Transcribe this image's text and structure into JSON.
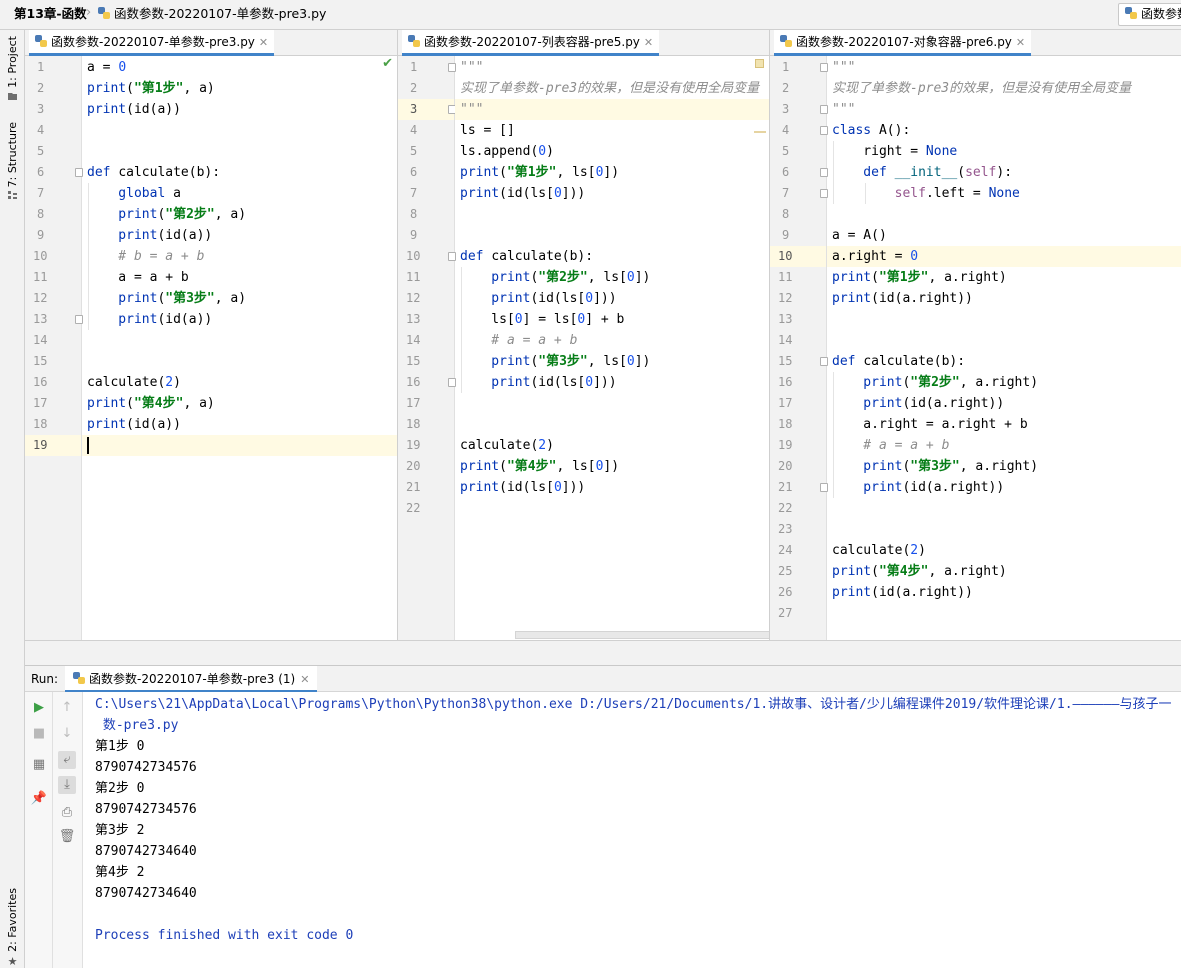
{
  "nav": {
    "crumbs": [
      "第13章-函数",
      "函数参数-20220107-单参数-pre3.py"
    ],
    "run_config": "函数参数"
  },
  "left_strip": {
    "project_tab": "1: Project",
    "structure_tab": "7: Structure",
    "favorites_tab": "2: Favorites"
  },
  "editors": [
    {
      "tab": "函数参数-20220107-单参数-pre3.py",
      "current_line": 19,
      "lines": [
        [
          [
            "a = ",
            ""
          ],
          [
            "0",
            "num"
          ]
        ],
        [
          [
            "print",
            "kw"
          ],
          [
            "(",
            ""
          ],
          [
            "\"第1步\"",
            "str"
          ],
          [
            ", a)",
            ""
          ]
        ],
        [
          [
            "print",
            "kw"
          ],
          [
            "(id(a))",
            ""
          ]
        ],
        [],
        [],
        [
          [
            "def ",
            "kw"
          ],
          [
            "calculate",
            ""
          ],
          [
            "(b):",
            ""
          ]
        ],
        [
          [
            "    global ",
            "kw"
          ],
          [
            "a",
            ""
          ]
        ],
        [
          [
            "    print",
            "kw"
          ],
          [
            "(",
            ""
          ],
          [
            "\"第2步\"",
            "str"
          ],
          [
            ", a)",
            ""
          ]
        ],
        [
          [
            "    print",
            "kw"
          ],
          [
            "(id(a))",
            ""
          ]
        ],
        [
          [
            "    # b = a + b",
            "cmt"
          ]
        ],
        [
          [
            "    a = a + b",
            ""
          ]
        ],
        [
          [
            "    print",
            "kw"
          ],
          [
            "(",
            ""
          ],
          [
            "\"第3步\"",
            "str"
          ],
          [
            ", a)",
            ""
          ]
        ],
        [
          [
            "    print",
            "kw"
          ],
          [
            "(id(a))",
            ""
          ]
        ],
        [],
        [],
        [
          [
            "calculate(",
            ""
          ],
          [
            "2",
            "num"
          ],
          [
            ")",
            ""
          ]
        ],
        [
          [
            "print",
            "kw"
          ],
          [
            "(",
            ""
          ],
          [
            "\"第4步\"",
            "str"
          ],
          [
            ", a)",
            ""
          ]
        ],
        [
          [
            "print",
            "kw"
          ],
          [
            "(id(a))",
            ""
          ]
        ],
        []
      ]
    },
    {
      "tab": "函数参数-20220107-列表容器-pre5.py",
      "current_line": 3,
      "lines": [
        [
          [
            "\"\"\"",
            "cmt"
          ]
        ],
        [
          [
            "实现了单参数-pre3的效果，但是没有使用全局变量",
            "cmt"
          ]
        ],
        [
          [
            "\"\"\"",
            "cmt"
          ]
        ],
        [
          [
            "ls = []",
            ""
          ]
        ],
        [
          [
            "ls.append(",
            ""
          ],
          [
            "0",
            "num"
          ],
          [
            ")",
            ""
          ]
        ],
        [
          [
            "print",
            "kw"
          ],
          [
            "(",
            ""
          ],
          [
            "\"第1步\"",
            "str"
          ],
          [
            ", ls[",
            ""
          ],
          [
            "0",
            "num"
          ],
          [
            "])",
            ""
          ]
        ],
        [
          [
            "print",
            "kw"
          ],
          [
            "(id(ls[",
            ""
          ],
          [
            "0",
            "num"
          ],
          [
            "]))",
            ""
          ]
        ],
        [],
        [],
        [
          [
            "def ",
            "kw"
          ],
          [
            "calculate",
            ""
          ],
          [
            "(b):",
            ""
          ]
        ],
        [
          [
            "    print",
            "kw"
          ],
          [
            "(",
            ""
          ],
          [
            "\"第2步\"",
            "str"
          ],
          [
            ", ls[",
            ""
          ],
          [
            "0",
            "num"
          ],
          [
            "])",
            ""
          ]
        ],
        [
          [
            "    print",
            "kw"
          ],
          [
            "(id(ls[",
            ""
          ],
          [
            "0",
            "num"
          ],
          [
            "]))",
            ""
          ]
        ],
        [
          [
            "    ls[",
            ""
          ],
          [
            "0",
            "num"
          ],
          [
            "] = ls[",
            ""
          ],
          [
            "0",
            "num"
          ],
          [
            "] + b",
            ""
          ]
        ],
        [
          [
            "    # a = a + b",
            "cmt"
          ]
        ],
        [
          [
            "    print",
            "kw"
          ],
          [
            "(",
            ""
          ],
          [
            "\"第3步\"",
            "str"
          ],
          [
            ", ls[",
            ""
          ],
          [
            "0",
            "num"
          ],
          [
            "])",
            ""
          ]
        ],
        [
          [
            "    print",
            "kw"
          ],
          [
            "(id(ls[",
            ""
          ],
          [
            "0",
            "num"
          ],
          [
            "]))",
            ""
          ]
        ],
        [],
        [],
        [
          [
            "calculate(",
            ""
          ],
          [
            "2",
            "num"
          ],
          [
            ")",
            ""
          ]
        ],
        [
          [
            "print",
            "kw"
          ],
          [
            "(",
            ""
          ],
          [
            "\"第4步\"",
            "str"
          ],
          [
            ", ls[",
            ""
          ],
          [
            "0",
            "num"
          ],
          [
            "])",
            ""
          ]
        ],
        [
          [
            "print",
            "kw"
          ],
          [
            "(id(ls[",
            ""
          ],
          [
            "0",
            "num"
          ],
          [
            "]))",
            ""
          ]
        ],
        []
      ]
    },
    {
      "tab": "函数参数-20220107-对象容器-pre6.py",
      "current_line": 10,
      "lines": [
        [
          [
            "\"\"\"",
            "cmt"
          ]
        ],
        [
          [
            "实现了单参数-pre3的效果，但是没有使用全局变量",
            "cmt"
          ]
        ],
        [
          [
            "\"\"\"",
            "cmt"
          ]
        ],
        [
          [
            "class ",
            "kw"
          ],
          [
            "A():",
            ""
          ]
        ],
        [
          [
            "    right = ",
            ""
          ],
          [
            "None",
            "kw"
          ]
        ],
        [
          [
            "    def ",
            "kw"
          ],
          [
            "__init__",
            "fn"
          ],
          [
            "(",
            ""
          ],
          [
            "self",
            "sp"
          ],
          [
            "):",
            ""
          ]
        ],
        [
          [
            "        ",
            ""
          ],
          [
            "self",
            "sp"
          ],
          [
            ".left = ",
            ""
          ],
          [
            "None",
            "kw"
          ]
        ],
        [],
        [
          [
            "a = A()",
            ""
          ]
        ],
        [
          [
            "a.right = ",
            ""
          ],
          [
            "0",
            "num"
          ]
        ],
        [
          [
            "print",
            "kw"
          ],
          [
            "(",
            ""
          ],
          [
            "\"第1步\"",
            "str"
          ],
          [
            ", a.right)",
            ""
          ]
        ],
        [
          [
            "print",
            "kw"
          ],
          [
            "(id(a.right))",
            ""
          ]
        ],
        [],
        [],
        [
          [
            "def ",
            "kw"
          ],
          [
            "calculate",
            ""
          ],
          [
            "(b):",
            ""
          ]
        ],
        [
          [
            "    print",
            "kw"
          ],
          [
            "(",
            ""
          ],
          [
            "\"第2步\"",
            "str"
          ],
          [
            ", a.right)",
            ""
          ]
        ],
        [
          [
            "    print",
            "kw"
          ],
          [
            "(id(a.right))",
            ""
          ]
        ],
        [
          [
            "    a.right = a.right + b",
            ""
          ]
        ],
        [
          [
            "    # a = a + b",
            "cmt"
          ]
        ],
        [
          [
            "    print",
            "kw"
          ],
          [
            "(",
            ""
          ],
          [
            "\"第3步\"",
            "str"
          ],
          [
            ", a.right)",
            ""
          ]
        ],
        [
          [
            "    print",
            "kw"
          ],
          [
            "(id(a.right))",
            ""
          ]
        ],
        [],
        [],
        [
          [
            "calculate(",
            ""
          ],
          [
            "2",
            "num"
          ],
          [
            ")",
            ""
          ]
        ],
        [
          [
            "print",
            "kw"
          ],
          [
            "(",
            ""
          ],
          [
            "\"第4步\"",
            "str"
          ],
          [
            ", a.right)",
            ""
          ]
        ],
        [
          [
            "print",
            "kw"
          ],
          [
            "(id(a.right))",
            ""
          ]
        ],
        []
      ]
    }
  ],
  "run": {
    "label": "Run:",
    "tab": "函数参数-20220107-单参数-pre3 (1)",
    "output": [
      {
        "text": "C:\\Users\\21\\AppData\\Local\\Programs\\Python\\Python38\\python.exe D:/Users/21/Documents/1.讲故事、设计者/少儿编程课件2019/软件理论课/1.——————与孩子一",
        "sys": true
      },
      {
        "text": " 数-pre3.py",
        "sys": true
      },
      {
        "text": "第1步 0",
        "sys": false
      },
      {
        "text": "8790742734576",
        "sys": false
      },
      {
        "text": "第2步 0",
        "sys": false
      },
      {
        "text": "8790742734576",
        "sys": false
      },
      {
        "text": "第3步 2",
        "sys": false
      },
      {
        "text": "8790742734640",
        "sys": false
      },
      {
        "text": "第4步 2",
        "sys": false
      },
      {
        "text": "8790742734640",
        "sys": false
      },
      {
        "text": "",
        "sys": false
      },
      {
        "text": "Process finished with exit code 0",
        "sys": true
      }
    ]
  }
}
